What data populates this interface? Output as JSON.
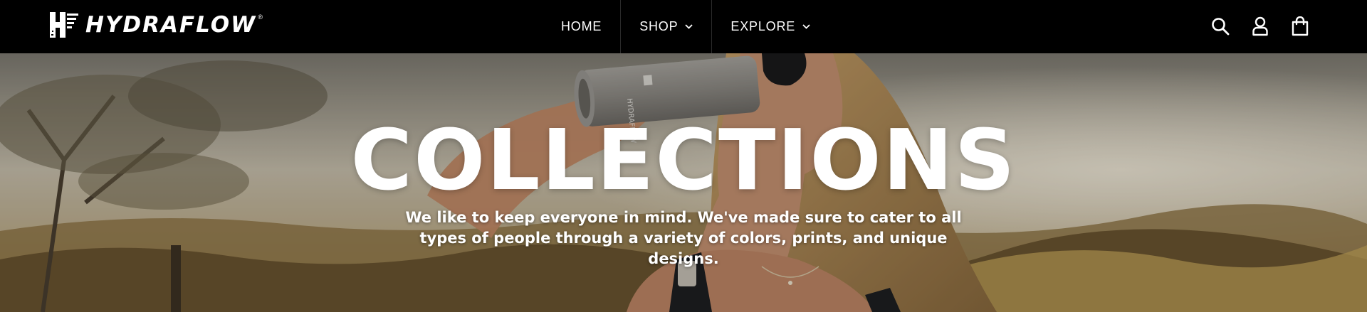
{
  "brand": {
    "name": "HYDRAFLOW",
    "registered_mark": "®",
    "logo_icon": "hydraflow-h-logo"
  },
  "nav": {
    "items": [
      {
        "label": "HOME",
        "has_dropdown": false
      },
      {
        "label": "SHOP",
        "has_dropdown": true,
        "icon": "chevron-down-icon"
      },
      {
        "label": "EXPLORE",
        "has_dropdown": true,
        "icon": "chevron-down-icon"
      }
    ]
  },
  "header_icons": [
    "search-icon",
    "account-icon",
    "cart-icon"
  ],
  "hero": {
    "title": "COLLECTIONS",
    "subtitle": "We like to keep everyone in mind. We've made sure to cater to all types of people through a variety of colors, prints, and unique designs.",
    "image_description_icon": "woman-drinking-from-tumbler-photo"
  },
  "colors": {
    "header_bg": "#000000",
    "text": "#ffffff"
  }
}
